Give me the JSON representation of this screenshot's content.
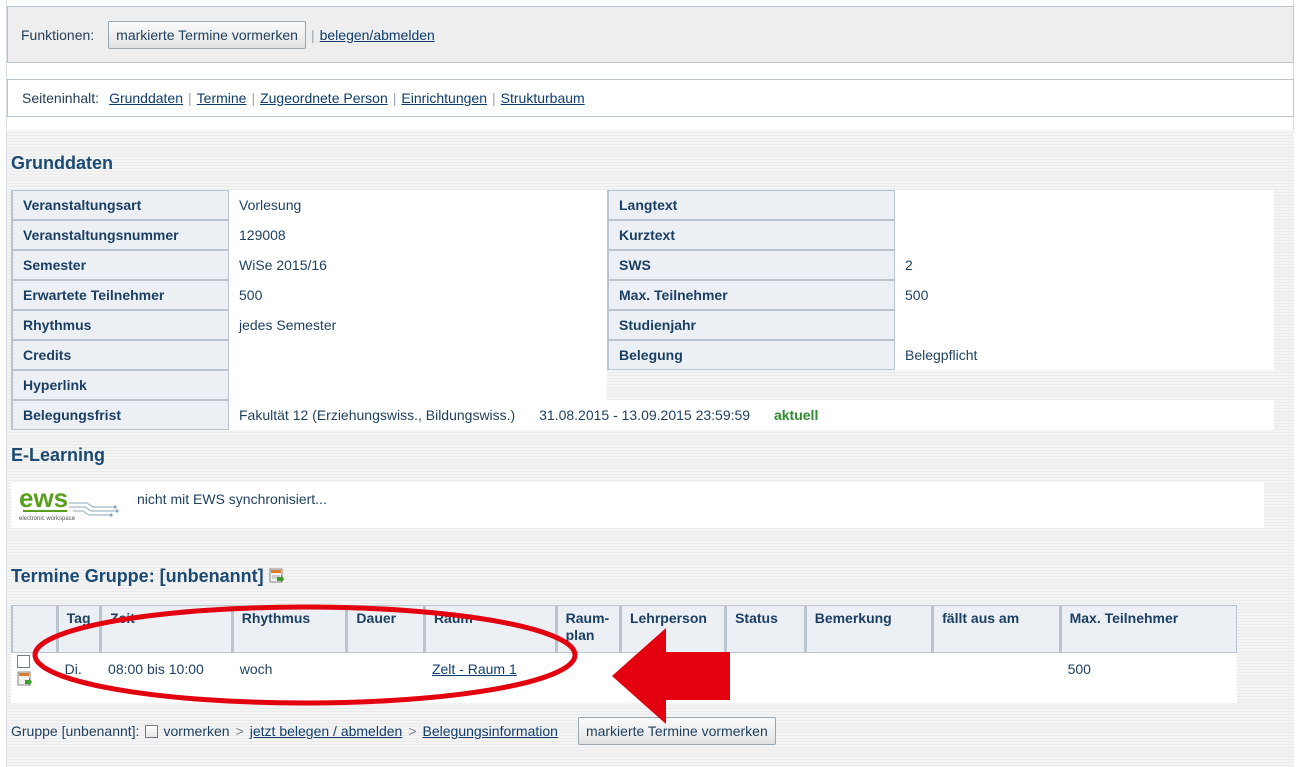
{
  "funktionen": {
    "label": "Funktionen:",
    "button": "markierte Termine vormerken",
    "link": "belegen/abmelden"
  },
  "seiteninhalt": {
    "label": "Seiteninhalt:",
    "links": [
      "Grunddaten",
      "Termine",
      "Zugeordnete Person",
      "Einrichtungen",
      "Strukturbaum"
    ]
  },
  "grunddaten": {
    "title": "Grunddaten",
    "rows": [
      {
        "k1": "Veranstaltungsart",
        "v1": "Vorlesung",
        "k2": "Langtext",
        "v2": ""
      },
      {
        "k1": "Veranstaltungsnummer",
        "v1": "129008",
        "k2": "Kurztext",
        "v2": ""
      },
      {
        "k1": "Semester",
        "v1": "WiSe 2015/16",
        "k2": "SWS",
        "v2": "2"
      },
      {
        "k1": "Erwartete Teilnehmer",
        "v1": "500",
        "k2": "Max. Teilnehmer",
        "v2": "500"
      },
      {
        "k1": "Rhythmus",
        "v1": "jedes Semester",
        "k2": "Studienjahr",
        "v2": ""
      },
      {
        "k1": "Credits",
        "v1": "",
        "k2": "Belegung",
        "v2": "Belegpflicht"
      },
      {
        "k1": "Hyperlink",
        "v1": ""
      }
    ],
    "belegungsfrist": {
      "label": "Belegungsfrist",
      "fakultaet": "Fakultät 12 (Erziehungswiss., Bildungswiss.)",
      "zeitraum": "31.08.2015 - 13.09.2015 23:59:59",
      "status": "aktuell"
    }
  },
  "elearning": {
    "title": "E-Learning",
    "logo_text": "ews",
    "logo_subtext": "electronic workspace",
    "status": "nicht mit EWS synchronisiert..."
  },
  "termine": {
    "title": "Termine Gruppe: [unbenannt]",
    "headers": [
      "",
      "Tag",
      "Zeit",
      "Rhythmus",
      "Dauer",
      "Raum",
      "Raum-plan",
      "Lehrperson",
      "Status",
      "Bemerkung",
      "fällt aus am",
      "Max. Teilnehmer"
    ],
    "row": {
      "tag": "Di.",
      "zeit": "08:00 bis 10:00",
      "rhythmus": "woch",
      "dauer": "",
      "raum": "Zelt - Raum 1",
      "raumplan": "",
      "lehrperson": "",
      "status": "",
      "bemerkung": "",
      "faellt_aus": "",
      "max": "500"
    }
  },
  "gruppe": {
    "label": "Gruppe [unbenannt]:",
    "vormerken": "vormerken",
    "belegen_link": "jetzt belegen / abmelden",
    "info_link": "Belegungsinformation",
    "button": "markierte Termine vormerken"
  },
  "colors": {
    "heading": "#1b4a72",
    "aktuell": "#2e8b2e",
    "annotation": "#e3000f"
  }
}
